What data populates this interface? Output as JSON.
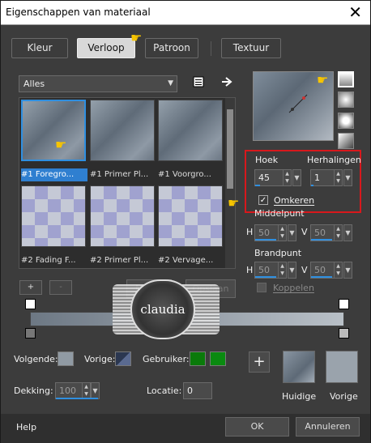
{
  "window": {
    "title": "Eigenschappen van materiaal",
    "close_glyph": "✕"
  },
  "tabs": [
    {
      "label": "Kleur"
    },
    {
      "label": "Verloop"
    },
    {
      "label": "Patroon"
    },
    {
      "label": "Textuur"
    }
  ],
  "library": {
    "category": "Alles",
    "items": [
      {
        "label": "#1 Foregro..."
      },
      {
        "label": "#1 Primer Pl..."
      },
      {
        "label": "#1 Voorgro..."
      },
      {
        "label": "#2 Fading F..."
      },
      {
        "label": "#2 Primer Pl..."
      },
      {
        "label": "#2 Vervage..."
      }
    ]
  },
  "controls": {
    "angle_label": "Hoek",
    "angle_value": "45",
    "repeats_label": "Herhalingen",
    "repeats_value": "1",
    "invert_label": "Omkeren",
    "invert_checked": true,
    "center_label": "Middelpunt",
    "focal_label": "Brandpunt",
    "h_label": "H",
    "v_label": "V",
    "center_h": "50",
    "center_v": "50",
    "focal_h": "50",
    "focal_v": "50",
    "link_label": "Koppelen",
    "link_checked": false
  },
  "editor": {
    "add": "+",
    "remove": "-",
    "new_label": "Nieuw",
    "save_label": "Opslaan",
    "next_label": "Volgende:",
    "prev_label": "Vorige:",
    "user_label": "Gebruiker:",
    "opacity_label": "Dekking:",
    "opacity_value": "100",
    "location_label": "Locatie:",
    "location_value": "0"
  },
  "swatches": {
    "current_label": "Huidige",
    "previous_label": "Vorige",
    "add_button": "+",
    "user_colors": [
      "#0a7a0a",
      "#0a8a10"
    ]
  },
  "footer": {
    "help": "Help",
    "ok": "OK",
    "cancel": "Annuleren"
  },
  "watermark": {
    "text": "claudia"
  },
  "icons": [
    "close-icon",
    "library-list-icon",
    "arrow-right-icon",
    "pointing-hand-icon",
    "gradient-style-icon",
    "plus-icon"
  ],
  "colors": {
    "accent": "#2f8fe0",
    "highlight_box": "#d8181c"
  }
}
